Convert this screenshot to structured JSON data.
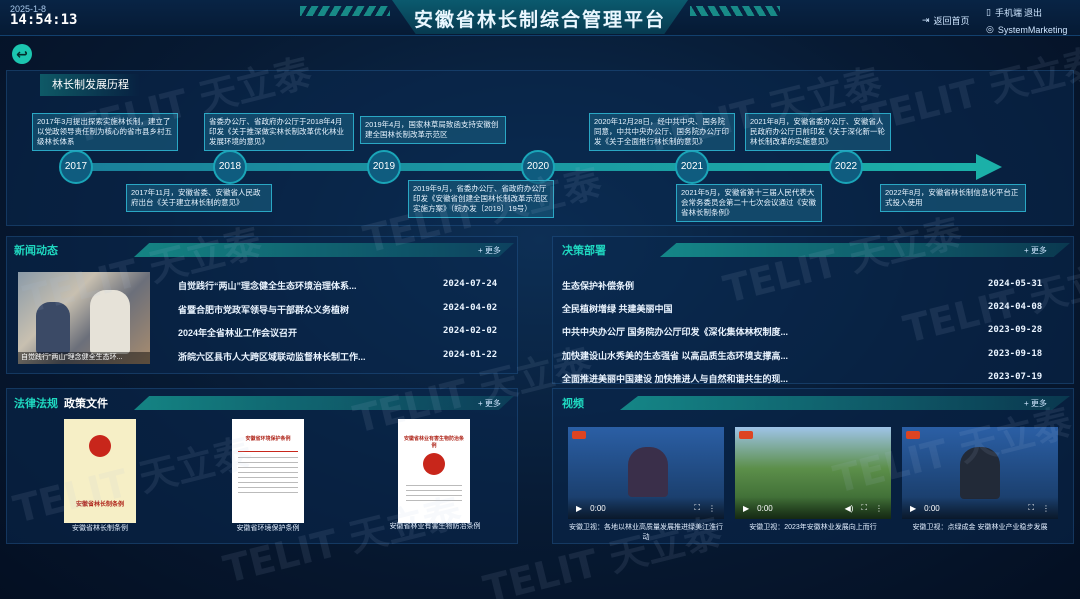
{
  "header": {
    "date": "2025-1-8",
    "time": "14:54:13",
    "title": "安徽省林长制综合管理平台",
    "home_label": "返回首页",
    "phone_label": "手机端",
    "logout_label": "退出",
    "user_label": "SystemMarketing"
  },
  "timeline": {
    "tab_label": "林长制发展历程",
    "years": [
      "2017",
      "2018",
      "2019",
      "2020",
      "2021",
      "2022"
    ],
    "events_top": [
      "2017年3月提出探索实施林长制，建立了以党政领导责任制为核心的省市县乡村五级林长体系",
      "省委办公厅、省政府办公厅于2018年4月印发《关于推深做实林长制改革优化林业发展环境的意见》",
      "2019年4月，国家林草局致函支持安徽创建全国林长制改革示范区",
      "2020年12月28日，经中共中央、国务院同意，中共中央办公厅、国务院办公厅印发《关于全面推行林长制的意见》",
      "2021年8月，安徽省委办公厅、安徽省人民政府办公厅日前印发《关于深化新一轮林长制改革的实施意见》"
    ],
    "events_bottom": [
      "2017年11月，安徽省委、安徽省人民政府出台《关于建立林长制的意见》",
      "2019年9月，省委办公厅、省政府办公厅印发《安徽省创建全国林长制改革示范区实施方案》（皖办发〔2019〕19号）",
      "2021年5月，安徽省第十三届人民代表大会常务委员会第二十七次会议通过《安徽省林长制条例》",
      "2022年8月，安徽省林长制信息化平台正式投入使用"
    ]
  },
  "news": {
    "title": "新闻动态",
    "more_label": "更多",
    "photo_caption": "自觉践行“两山”理念健全生态环...",
    "items": [
      {
        "title": "自觉践行“两山”理念健全生态环境治理体系...",
        "date": "2024-07-24"
      },
      {
        "title": "省暨合肥市党政军领导与干部群众义务植树",
        "date": "2024-04-02"
      },
      {
        "title": "2024年全省林业工作会议召开",
        "date": "2024-02-02"
      },
      {
        "title": "浙皖六区县市人大跨区域联动监督林长制工作...",
        "date": "2024-01-22"
      }
    ]
  },
  "decisions": {
    "title": "决策部署",
    "more_label": "更多",
    "items": [
      {
        "title": "生态保护补偿条例",
        "date": "2024-05-31"
      },
      {
        "title": "全民植树增绿 共建美丽中国",
        "date": "2024-04-08"
      },
      {
        "title": "中共中央办公厅 国务院办公厅印发《深化集体林权制度...",
        "date": "2023-09-28"
      },
      {
        "title": "加快建设山水秀美的生态强省 以高品质生态环境支撑高...",
        "date": "2023-09-18"
      },
      {
        "title": "全面推进美丽中国建设 加快推进人与自然和谐共生的现...",
        "date": "2023-07-19"
      }
    ]
  },
  "law": {
    "title_a": "法律法规",
    "title_b": "政策文件",
    "more_label": "更多",
    "docs": [
      {
        "label": "安徽省林长制条例",
        "cover_title": "安徽省林长制条例"
      },
      {
        "label": "安徽省环境保护条例",
        "cover_title": "安徽省环境保护条例"
      },
      {
        "label": "安徽省林业有害生物防治条例",
        "cover_title": "安徽省林业有害生物防治条例"
      }
    ]
  },
  "video": {
    "title": "视频",
    "more_label": "更多",
    "time_label": "0:00",
    "items": [
      {
        "caption": "安徽卫视：各地以林业高质量发展推进绿美江淮行动"
      },
      {
        "caption": "安徽卫视：2023年安徽林业发展向上而行"
      },
      {
        "caption": "安徽卫视：点绿成金 安徽林业产业稳步发展"
      }
    ]
  },
  "watermark_text": "TELIT 天立泰",
  "colors": {
    "accent": "#1fd8c0",
    "background": "#071a33",
    "timeline": "#1bb0a8"
  }
}
